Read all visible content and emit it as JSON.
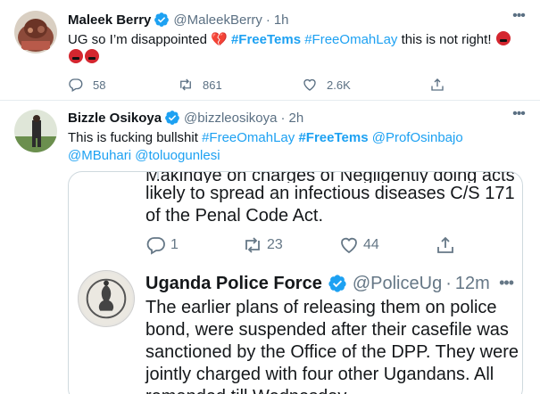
{
  "tweet1": {
    "name": "Maleek Berry",
    "handle": "@MaleekBerry",
    "separator": "·",
    "time": "1h",
    "text_start": "UG so I’m disappointed ",
    "heart": "💔",
    "tag1": "#FreeTems",
    "tag2": "#FreeOmahLay",
    "text_end": " this is not right! ",
    "replies": "58",
    "retweets": "861",
    "likes": "2.6K"
  },
  "tweet2": {
    "name": "Bizzle Osikoya",
    "handle": "@bizzleosikoya",
    "separator": "·",
    "time": "2h",
    "text_start": "This is fucking bullshit ",
    "tag1": "#FreeOmahLay",
    "tag2": "#FreeTems",
    "mention1": "@ProfOsinbajo",
    "mention2": "@MBuhari",
    "mention3": "@toluogunlesi",
    "quote": {
      "cut_line": "Makindye on charges of Negligently doing acts",
      "line1": "likely to spread an infectious diseases C/S 171",
      "line2": "of the Penal Code Act.",
      "replies": "1",
      "retweets": "23",
      "likes": "44",
      "police_name": "Uganda Police Force",
      "police_handle": "@PoliceUg",
      "police_separator": "·",
      "police_time": "12m",
      "police_text": "The earlier plans of releasing them on police bond, were suspended after their casefile was sanctioned by the Office of the DPP. They were jointly charged with four other Ugandans. All remanded till Wednesday"
    }
  },
  "icons": [
    "more-icon",
    "verified-icon",
    "reply-icon",
    "retweet-icon",
    "like-icon",
    "share-icon"
  ],
  "colors": {
    "accent": "#1da1f2",
    "muted": "#5b7083",
    "border": "#e6ecf0",
    "verified": "#1da1f2"
  }
}
